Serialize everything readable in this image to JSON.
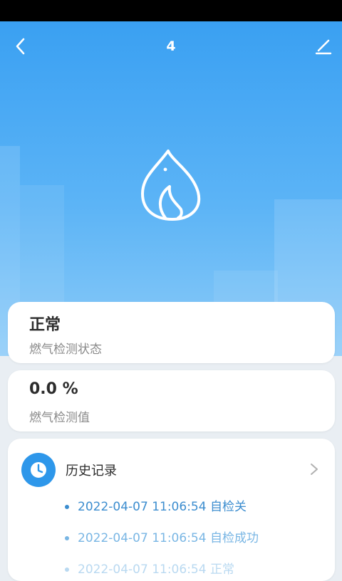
{
  "header": {
    "title": "4",
    "back_icon": "chevron-left-icon",
    "edit_icon": "pencil-icon"
  },
  "hero": {
    "icon": "flame-icon",
    "gradient_colors": [
      "#3aa0f2",
      "#8ccbf8"
    ]
  },
  "status_card": {
    "value": "正常",
    "label": "燃气检测状态"
  },
  "value_card": {
    "value": "0.0 %",
    "label": "燃气检测值"
  },
  "history": {
    "icon": "clock-icon",
    "title": "历史记录",
    "more_icon": "chevron-right-icon",
    "accent_color": "#2e97ea",
    "records": [
      {
        "text": "2022-04-07 11:06:54 自检关"
      },
      {
        "text": "2022-04-07 11:06:54 自检成功"
      },
      {
        "text": "2022-04-07 11:06:54 正常"
      }
    ]
  }
}
